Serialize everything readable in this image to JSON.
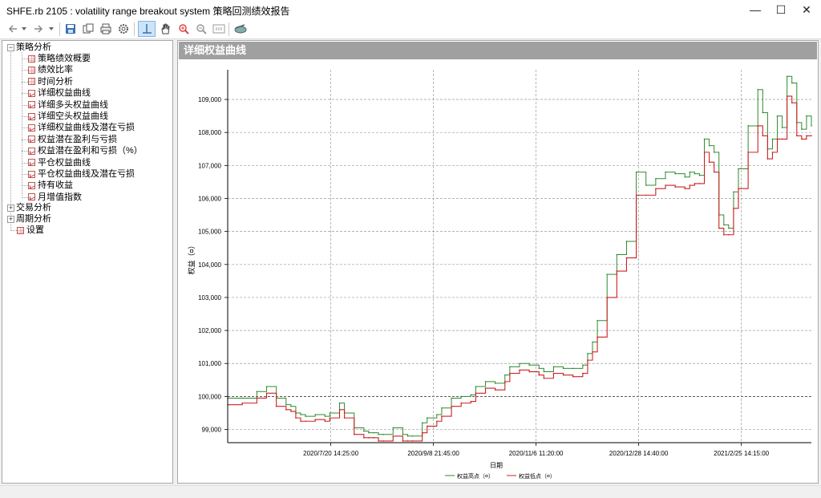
{
  "window": {
    "title": "SHFE.rb 2105 : volatility range breakout system 策略回测绩效报告",
    "minimize": "—",
    "maximize": "☐",
    "close": "✕"
  },
  "toolbar": {
    "buttons": [
      "back-icon",
      "dropdown-icon",
      "forward-icon",
      "dropdown-icon",
      "save-icon",
      "copy-icon",
      "print-icon",
      "settings-icon",
      "crosshair-icon",
      "pan-hand-icon",
      "zoom-in-icon",
      "zoom-out-icon",
      "zoom-fit-icon",
      "export-icon"
    ]
  },
  "tree": {
    "root": "策略分析",
    "children": [
      "策略绩效概要",
      "绩效比率",
      "时间分析",
      "详细权益曲线",
      "详细多头权益曲线",
      "详细空头权益曲线",
      "详细权益曲线及潜在亏损",
      "权益潜在盈利与亏损",
      "权益潜在盈利和亏损（%）",
      "平仓权益曲线",
      "平仓权益曲线及潜在亏损",
      "持有收益",
      "月增值指数"
    ],
    "other": [
      "交易分析",
      "周期分析",
      "设置"
    ]
  },
  "panel": {
    "header": "详细权益曲线"
  },
  "chart_data": {
    "type": "line",
    "xlabel": "日期",
    "ylabel": "权益（¤）",
    "ylim": [
      98600,
      109900
    ],
    "yticks": [
      "99,000",
      "100,000",
      "101,000",
      "102,000",
      "103,000",
      "104,000",
      "105,000",
      "106,000",
      "107,000",
      "108,000",
      "109,000"
    ],
    "ytick_values": [
      99000,
      100000,
      101000,
      102000,
      103000,
      104000,
      105000,
      106000,
      107000,
      108000,
      109000
    ],
    "xticks": [
      "2020/7/20 14:25:00",
      "2020/9/8 21:45:00",
      "2020/11/6 11:20:00",
      "2020/12/28 14:40:00",
      "2021/2/25 14:15:00"
    ],
    "baseline": 100000,
    "grid": true,
    "legend_position": "bottom",
    "series": [
      {
        "name": "权益高点（¤）",
        "color": "#2e8b2e",
        "x": [
          0,
          3,
          6,
          8,
          10,
          12,
          13,
          14,
          15,
          16,
          18,
          20,
          21,
          23,
          24,
          26,
          28,
          29,
          30,
          31,
          32,
          34,
          36,
          37,
          38,
          40,
          41,
          43,
          44,
          46,
          48,
          50,
          51,
          53,
          55,
          57,
          58,
          60,
          62,
          64,
          65,
          67,
          69,
          71,
          73,
          74,
          75,
          76,
          78,
          80,
          82,
          84,
          86,
          88,
          90,
          92,
          94,
          95,
          96,
          97,
          98,
          99,
          100,
          101,
          102,
          103,
          104,
          105,
          107,
          109,
          110,
          111,
          112,
          113,
          114,
          115,
          116,
          117,
          118,
          119,
          120
        ],
        "values": [
          99950,
          99950,
          100150,
          100300,
          99950,
          99750,
          99700,
          99500,
          99450,
          99400,
          99450,
          99400,
          99500,
          99800,
          99500,
          99050,
          98950,
          98900,
          98900,
          98850,
          98850,
          99050,
          98850,
          98800,
          98800,
          99200,
          99350,
          99450,
          99650,
          99950,
          100000,
          100050,
          100300,
          100450,
          100400,
          100650,
          100900,
          101000,
          100950,
          100850,
          100750,
          100900,
          100850,
          100850,
          100950,
          101300,
          101650,
          102300,
          103700,
          104300,
          104700,
          106800,
          106400,
          106600,
          106800,
          106750,
          106650,
          106800,
          106750,
          106700,
          107800,
          107600,
          107400,
          105500,
          105200,
          105100,
          106200,
          106900,
          108200,
          109300,
          108600,
          107500,
          107800,
          108500,
          108150,
          109700,
          109500,
          108300,
          108100,
          108500,
          108200
        ]
      },
      {
        "name": "权益低点（¤）",
        "color": "#cc2222",
        "x": [
          0,
          3,
          6,
          8,
          10,
          12,
          13,
          14,
          15,
          16,
          18,
          20,
          21,
          23,
          24,
          26,
          28,
          29,
          30,
          31,
          32,
          34,
          36,
          37,
          38,
          40,
          41,
          43,
          44,
          46,
          48,
          50,
          51,
          53,
          55,
          57,
          58,
          60,
          62,
          64,
          65,
          67,
          69,
          71,
          73,
          74,
          75,
          76,
          78,
          80,
          82,
          84,
          86,
          88,
          90,
          92,
          94,
          95,
          96,
          97,
          98,
          99,
          100,
          101,
          102,
          103,
          104,
          105,
          107,
          109,
          110,
          111,
          112,
          113,
          114,
          115,
          116,
          117,
          118,
          119,
          120
        ],
        "values": [
          99750,
          99800,
          99950,
          100100,
          99700,
          99600,
          99550,
          99350,
          99250,
          99250,
          99300,
          99250,
          99350,
          99600,
          99350,
          98850,
          98750,
          98750,
          98750,
          98650,
          98650,
          98800,
          98650,
          98650,
          98650,
          98900,
          99100,
          99250,
          99400,
          99700,
          99800,
          99850,
          100100,
          100250,
          100200,
          100450,
          100700,
          100800,
          100750,
          100650,
          100550,
          100700,
          100650,
          100600,
          100700,
          101100,
          101350,
          101800,
          103000,
          103800,
          104200,
          106100,
          106100,
          106300,
          106400,
          106350,
          106300,
          106400,
          106450,
          106450,
          107400,
          107100,
          106800,
          105100,
          104900,
          104900,
          105700,
          106300,
          107400,
          108200,
          107900,
          107200,
          107400,
          107800,
          107800,
          109100,
          108900,
          107900,
          107800,
          107900,
          107900
        ]
      }
    ]
  }
}
